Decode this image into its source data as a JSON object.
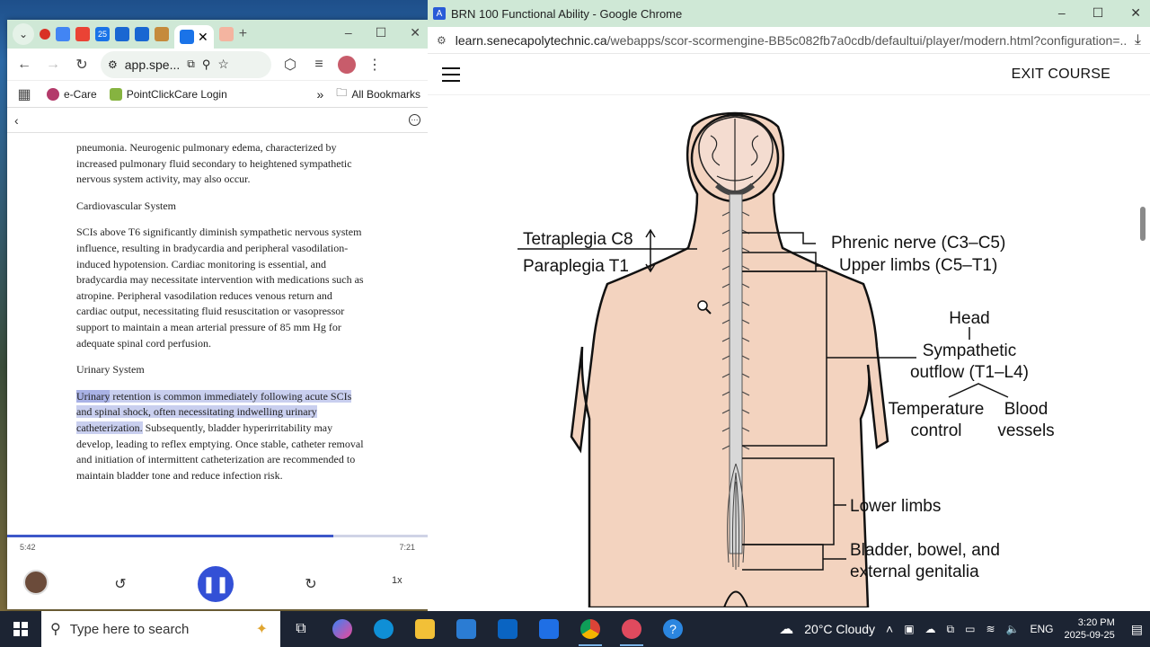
{
  "left_window": {
    "tab_icon_text": "25",
    "omnibox_text": "app.spe...",
    "bookmarks": [
      {
        "label": "e-Care"
      },
      {
        "label": "PointClickCare Login"
      }
    ],
    "more_bookmarks": "»",
    "all_bookmarks": "All Bookmarks",
    "reader": {
      "paragraph_top": "pneumonia. Neurogenic pulmonary edema, characterized by increased pulmonary fluid secondary to heightened sympathetic nervous system activity, may also occur.",
      "heading_cardio": "Cardiovascular System",
      "paragraph_cardio": "SCIs above T6 significantly diminish sympathetic nervous system influence, resulting in bradycardia and peripheral vasodilation-induced hypotension. Cardiac monitoring is essential, and bradycardia may necessitate intervention with medications such as atropine. Peripheral vasodilation reduces venous return and cardiac output, necessitating fluid resuscitation or vasopressor support to maintain a mean arterial pressure of 85 mm Hg for adequate spinal cord perfusion.",
      "heading_urinary": "Urinary System",
      "urinary_word": "Urinary",
      "urinary_highlight": " retention is common immediately following acute SCIs and spinal shock, often necessitating indwelling urinary catheterization.",
      "urinary_rest": " Subsequently, bladder hyperirritability may develop, leading to reflex emptying. Once stable, catheter removal and initiation of intermittent catheterization are recommended to maintain bladder tone and reduce infection risk."
    },
    "player": {
      "elapsed": "5:42",
      "total": "7:21",
      "progress_fraction": 0.776,
      "speed": "1x"
    }
  },
  "right_window": {
    "title": "BRN 100 Functional Ability - Google Chrome",
    "url_host": "learn.senecapolytechnic.ca",
    "url_path": "/webapps/scor-scormengine-BB5c082fb7a0cdb/defaultui/player/modern.html?configuration=...",
    "exit_label": "EXIT COURSE",
    "diagram": {
      "tetraplegia": "Tetraplegia C8",
      "paraplegia": "Paraplegia T1",
      "phrenic": "Phrenic nerve (C3–C5)",
      "upper_limbs": "Upper limbs (C5–T1)",
      "head": "Head",
      "sympathetic_1": "Sympathetic",
      "sympathetic_2": "outflow (T1–L4)",
      "temperature_1": "Temperature",
      "temperature_2": "control",
      "blood_1": "Blood",
      "blood_2": "vessels",
      "lower_limbs": "Lower limbs",
      "bladder_1": "Bladder, bowel, and",
      "bladder_2": "external genitalia"
    }
  },
  "taskbar": {
    "search_placeholder": "Type here to search",
    "weather": "20°C  Cloudy",
    "language": "ENG",
    "time": "3:20 PM",
    "date": "2025-09-25"
  },
  "colors": {
    "chrome_tab_bg": "#cfe8d6",
    "skin": "#f3d3bf",
    "player_accent": "#3350d6",
    "highlight": "#c9cfef"
  }
}
